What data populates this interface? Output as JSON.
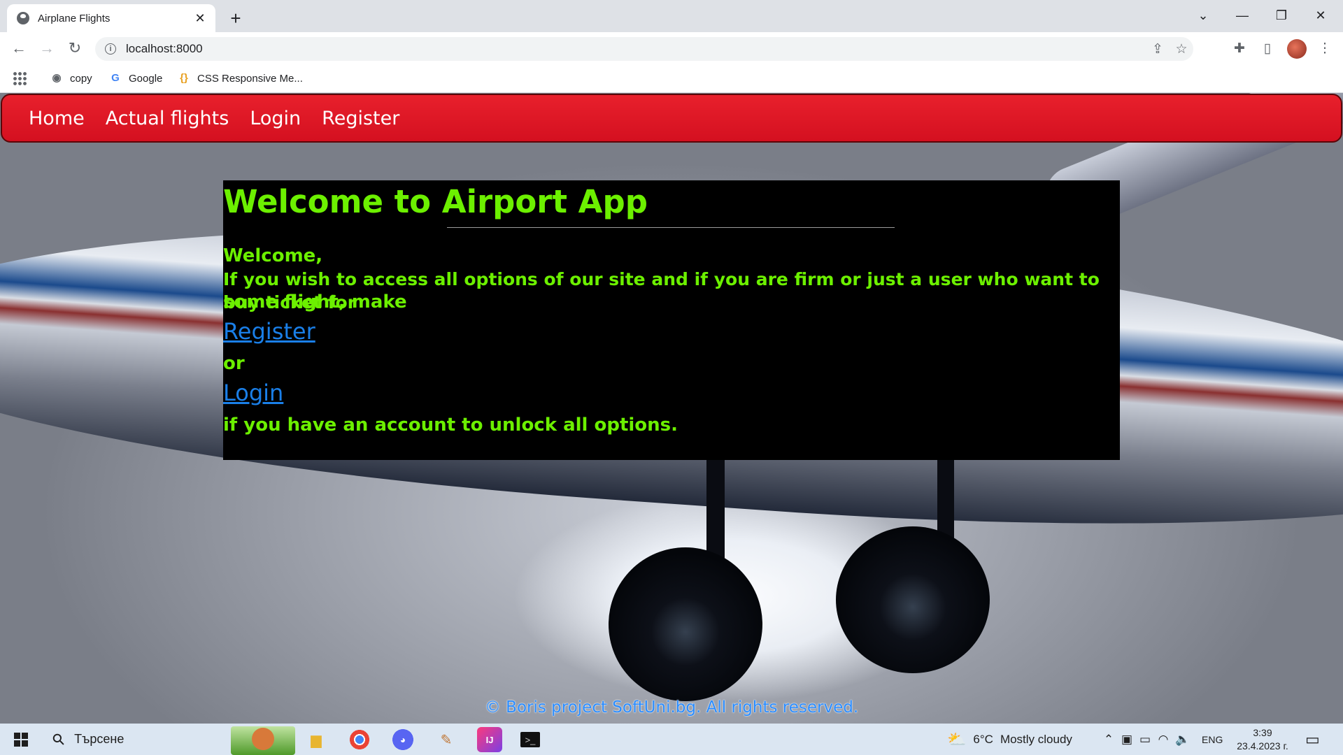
{
  "browser": {
    "tab_title": "Airplane Flights",
    "url": "localhost:8000",
    "bookmarks": [
      "copy",
      "Google",
      "CSS Responsive Me..."
    ]
  },
  "nav": {
    "items": [
      "Home",
      "Actual flights",
      "Login",
      "Register"
    ]
  },
  "welcome": {
    "heading": "Welcome to Airport App",
    "greeting": "Welcome,",
    "intro_line1": "If you wish to access all options of our site and if you are firm or just a user who want to buy ticket for",
    "intro_line2": "some flight, make",
    "register_link": "Register",
    "or_text": "or",
    "login_link": "Login",
    "closing": "if you have an account to unlock all options."
  },
  "footer": {
    "copyright": "© Boris project SoftUni.bg. All rights reserved."
  },
  "taskbar": {
    "search_placeholder": "Търсене",
    "weather_temp": "6°C",
    "weather_desc": "Mostly cloudy",
    "language": "ENG",
    "time": "3:39",
    "date": "23.4.2023 г."
  },
  "colors": {
    "nav_bg": "#e01a24",
    "heading_green": "#6cf000",
    "link_blue": "#1a7fe8",
    "box_bg": "#000000"
  },
  "icons": [
    "globe-icon",
    "close-icon",
    "plus-icon",
    "chevron-down-icon",
    "minimize-icon",
    "restore-icon",
    "back-icon",
    "forward-icon",
    "reload-icon",
    "info-icon",
    "share-icon",
    "star-icon",
    "puzzle-icon",
    "sidepanel-icon",
    "menu-icon",
    "apps-grid-icon",
    "windows-start-icon",
    "search-icon",
    "explorer-icon",
    "chrome-icon",
    "discord-icon",
    "paint-icon",
    "intellij-icon",
    "terminal-icon",
    "weather-icon",
    "wifi-icon",
    "volume-icon",
    "battery-icon",
    "notification-icon"
  ]
}
